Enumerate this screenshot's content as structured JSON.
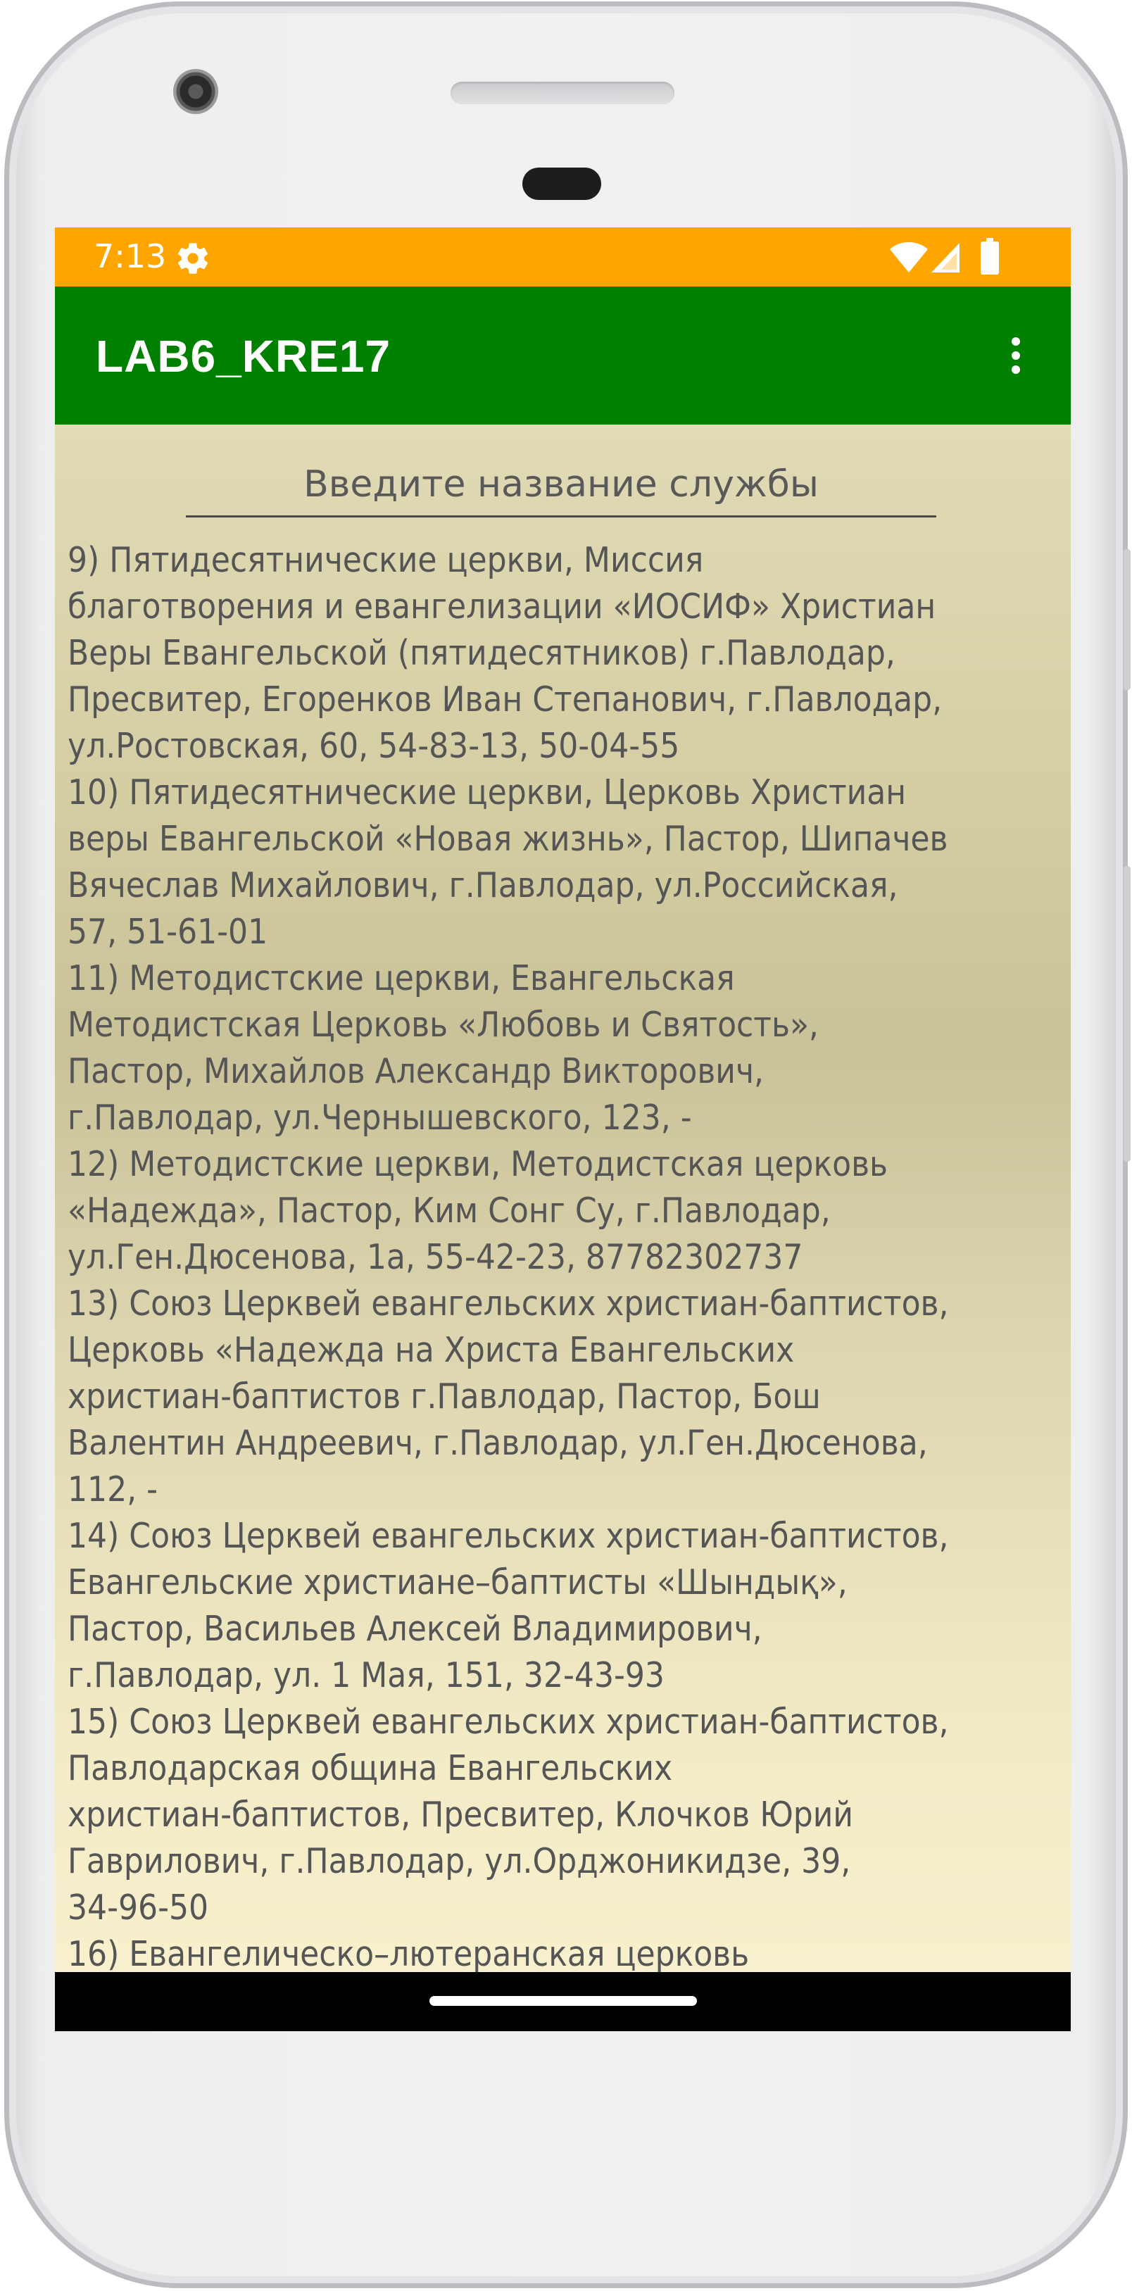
{
  "status_bar": {
    "time": "7:13",
    "color": "#FFA500",
    "icons": [
      "settings-icon",
      "wifi-icon",
      "signal-icon",
      "battery-icon"
    ]
  },
  "app_bar": {
    "title": "LAB6_KRE17",
    "color": "#008000",
    "menu_icon": "more-vert-icon"
  },
  "search": {
    "placeholder": "Введите название службы",
    "value": ""
  },
  "services": [
    [
      "9) Пятидесятнические церкви, Миссия",
      "благотворения и евангелизации «ИОСИФ» Христиан",
      "Веры Евангельской (пятидесятников) г.Павлодар,",
      "Пресвитер, Егоренков Иван Степанович, г.Павлодар,",
      "ул.Ростовская, 60, 54-83-13, 50-04-55"
    ],
    [
      "10) Пятидесятнические церкви, Церковь Христиан",
      "веры Евангельской «Новая жизнь», Пастор, Шипачев",
      "Вячеслав Михайлович, г.Павлодар, ул.Российская,",
      "57, 51-61-01"
    ],
    [
      "11) Методистские церкви, Евангельская",
      "Методистская Церковь «Любовь и Святость»,",
      "Пастор, Михайлов Александр Викторович,",
      "г.Павлодар, ул.Чернышевского, 123, -"
    ],
    [
      "12) Методистские церкви, Методистская церковь",
      "«Надежда», Пастор, Ким Сонг Су, г.Павлодар,",
      "ул.Ген.Дюсенова, 1а, 55-42-23, 87782302737"
    ],
    [
      "13) Союз Церквей евангельских христиан-баптистов,",
      "Церковь «Надежда на Христа Евангельских",
      "христиан-баптистов г.Павлодар, Пастор, Бош",
      "Валентин Андреевич, г.Павлодар, ул.Ген.Дюсенова,",
      "112, -"
    ],
    [
      "14) Союз Церквей евангельских христиан-баптистов,",
      "Евангельские христиане–баптисты «Шындық»,",
      "Пастор, Васильев Алексей Владимирович,",
      "г.Павлодар, ул. 1 Мая, 151, 32-43-93"
    ],
    [
      "15) Союз Церквей евангельских христиан-баптистов,",
      "Павлодарская община Евангельских",
      "христиан-баптистов, Пресвитер, Клочков Юрий",
      "Гаврилович, г.Павлодар, ул.Орджоникидзе, 39,",
      "34-96-50"
    ],
    [
      "16) Евангелическо–лютеранская церковь"
    ]
  ]
}
